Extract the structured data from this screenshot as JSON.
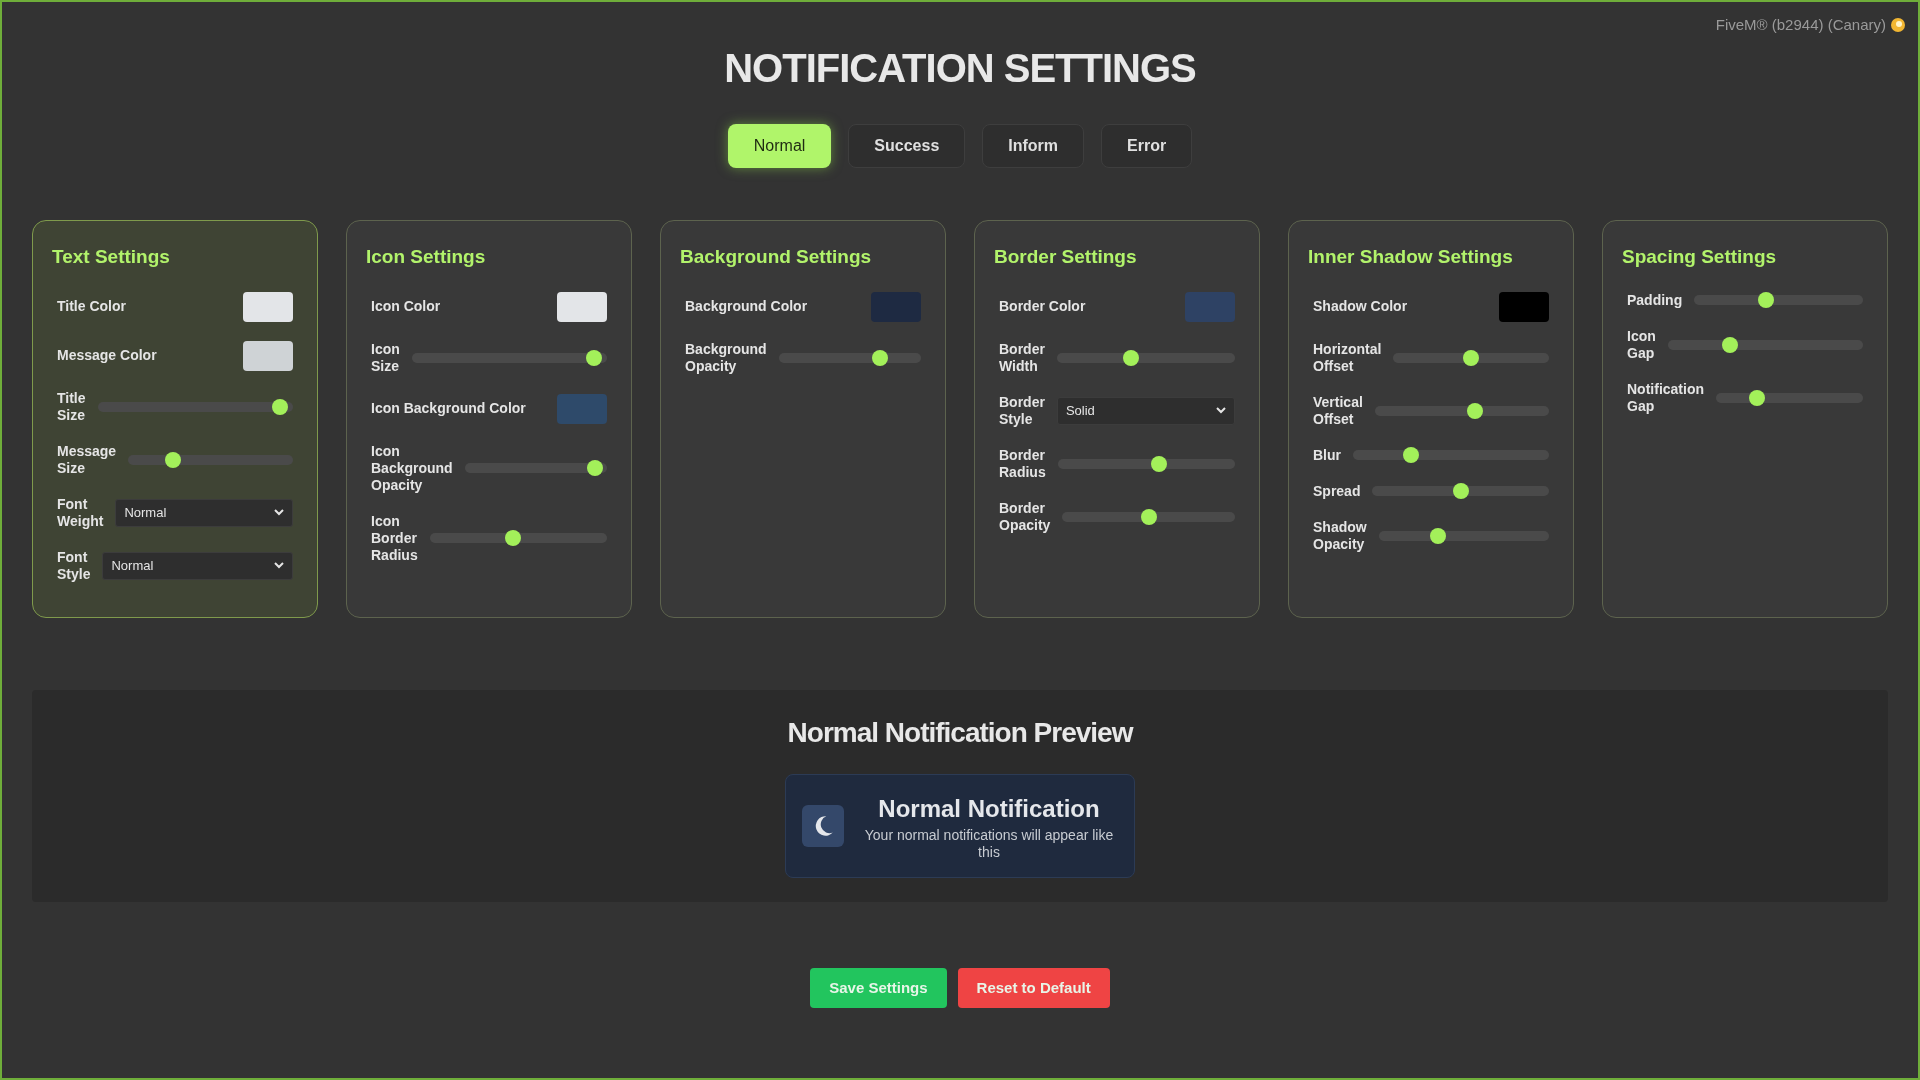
{
  "app_badge": "FiveM® (b2944) (Canary)",
  "title": "NOTIFICATION SETTINGS",
  "tabs": [
    {
      "label": "Normal",
      "selected": true
    },
    {
      "label": "Success",
      "selected": false
    },
    {
      "label": "Inform",
      "selected": false
    },
    {
      "label": "Error",
      "selected": false
    }
  ],
  "panels": [
    {
      "title": "Text Settings",
      "highlighted": true,
      "controls": [
        {
          "kind": "color",
          "label": "Title Color",
          "color": "#e3e5e8"
        },
        {
          "kind": "color",
          "label": "Message Color",
          "color": "#cfd3d6"
        },
        {
          "kind": "slider",
          "label": "Title Size",
          "level": 0.97
        },
        {
          "kind": "slider",
          "label": "Message Size",
          "level": 0.25
        },
        {
          "kind": "select",
          "label": "Font Weight",
          "value": "Normal"
        },
        {
          "kind": "select",
          "label": "Font Style",
          "value": "Normal"
        }
      ]
    },
    {
      "title": "Icon Settings",
      "highlighted": false,
      "controls": [
        {
          "kind": "color",
          "label": "Icon Color",
          "color": "#e3e5e8"
        },
        {
          "kind": "slider",
          "label": "Icon Size",
          "level": 0.97
        },
        {
          "kind": "color",
          "label": "Icon Background Color",
          "color": "#2e4a6a"
        },
        {
          "kind": "slider",
          "label": "Icon Background Opacity",
          "level": 0.97
        },
        {
          "kind": "slider",
          "label": "Icon Border Radius",
          "level": 0.47
        }
      ]
    },
    {
      "title": "Background Settings",
      "highlighted": false,
      "controls": [
        {
          "kind": "color",
          "label": "Background Color",
          "color": "#1e2a42"
        },
        {
          "kind": "slider",
          "label": "Background Opacity",
          "level": 0.74
        }
      ]
    },
    {
      "title": "Border Settings",
      "highlighted": false,
      "controls": [
        {
          "kind": "color",
          "label": "Border Color",
          "color": "#2e4264"
        },
        {
          "kind": "slider",
          "label": "Border Width",
          "level": 0.41
        },
        {
          "kind": "select",
          "label": "Border Style",
          "value": "Solid"
        },
        {
          "kind": "slider",
          "label": "Border Radius",
          "level": 0.58
        },
        {
          "kind": "slider",
          "label": "Border Opacity",
          "level": 0.5
        }
      ]
    },
    {
      "title": "Inner Shadow Settings",
      "highlighted": false,
      "controls": [
        {
          "kind": "color",
          "label": "Shadow Color",
          "color": "#000000"
        },
        {
          "kind": "slider",
          "label": "Horizontal Offset",
          "level": 0.5
        },
        {
          "kind": "slider",
          "label": "Vertical Offset",
          "level": 0.58
        },
        {
          "kind": "slider",
          "label": "Blur",
          "level": 0.28
        },
        {
          "kind": "slider",
          "label": "Spread",
          "level": 0.5
        },
        {
          "kind": "slider",
          "label": "Shadow Opacity",
          "level": 0.33
        }
      ]
    },
    {
      "title": "Spacing Settings",
      "highlighted": false,
      "controls": [
        {
          "kind": "slider",
          "label": "Padding",
          "level": 0.42
        },
        {
          "kind": "slider",
          "label": "Icon Gap",
          "level": 0.3
        },
        {
          "kind": "slider",
          "label": "Notification Gap",
          "level": 0.25
        }
      ]
    }
  ],
  "preview": {
    "heading": "Normal Notification Preview",
    "title": "Normal Notification",
    "message": "Your normal notifications will appear like this"
  },
  "buttons": [
    {
      "kind": "save",
      "label": "Save Settings"
    },
    {
      "kind": "reset",
      "label": "Reset to Default"
    }
  ]
}
